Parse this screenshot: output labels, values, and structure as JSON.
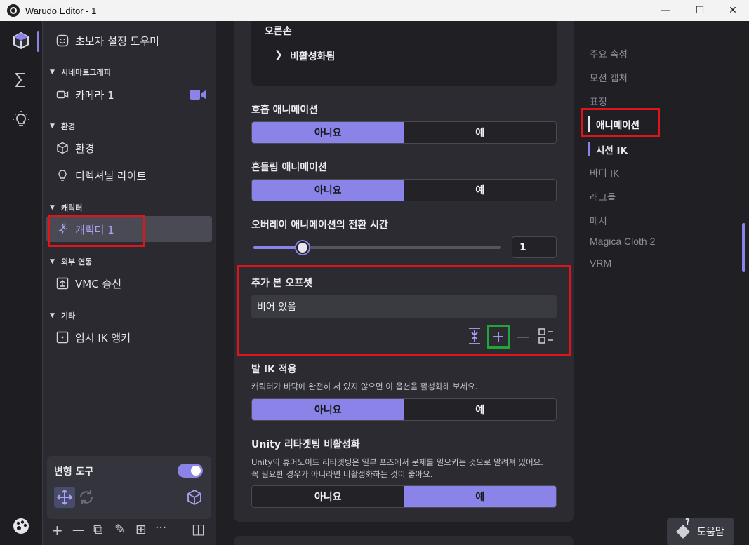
{
  "window": {
    "title": "Warudo Editor - 1",
    "controls": {
      "minimize": "—",
      "maximize": "☐",
      "close": "✕"
    }
  },
  "activity_bar": {
    "items": [
      {
        "name": "scene-cube",
        "glyph": "cube"
      },
      {
        "name": "sigma",
        "glyph": "Σ"
      },
      {
        "name": "lightbulb",
        "glyph": "bulb"
      }
    ]
  },
  "sidebar": {
    "beginner_wizard": "초보자 설정 도우미",
    "sections": {
      "cinematography": "시네마토그래피",
      "environment": "환경",
      "character": "캐릭터",
      "external": "외부 연동",
      "other": "기타"
    },
    "items": {
      "camera": "카메라 1",
      "environment": "환경",
      "directional_light": "디렉셔널 라이트",
      "character": "캐릭터 1",
      "vmc": "VMC 송신",
      "ik_anchor": "임시 IK 앵커"
    },
    "transform_tool": {
      "label": "변형 도구",
      "enabled": true
    },
    "bottom_toolbar": [
      "+",
      "—",
      "⧉",
      "✎",
      "⊞",
      "···",
      "◫"
    ]
  },
  "main": {
    "right_hand": {
      "label": "오른손",
      "status": "비활성화됨"
    },
    "breathing": {
      "label": "호흡 애니메이션",
      "no": "아니요",
      "yes": "예",
      "selected": "no"
    },
    "swaying": {
      "label": "흔들림 애니메이션",
      "no": "아니요",
      "yes": "예",
      "selected": "no"
    },
    "overlay_transition": {
      "label": "오버레이 애니메이션의 전환 시간",
      "value": "1",
      "slider_fraction": 0.2
    },
    "bone_offset": {
      "label": "추가 본 오프셋",
      "empty_text": "비어 있음",
      "tools": [
        "collapse",
        "add",
        "remove",
        "grid"
      ]
    },
    "foot_ik": {
      "label": "발 IK 적용",
      "desc": "캐릭터가 바닥에 완전히 서 있지 않으면 이 옵션을 활성화해 보세요.",
      "no": "아니요",
      "yes": "예",
      "selected": "no"
    },
    "unity_retarget": {
      "label": "Unity 리타겟팅 비활성화",
      "desc_line1": "Unity의 휴머노이드 리타겟팅은 일부 포즈에서 문제를 일으키는 것으로 알려져 있어요.",
      "desc_line2": "꼭 필요한 경우가 아니라면 비활성화하는 것이 좋아요.",
      "no": "아니요",
      "yes": "예",
      "selected": "yes"
    }
  },
  "right_nav": {
    "items": [
      "주요 속성",
      "모션 캡처",
      "표정",
      "애니메이션",
      "시선 IK",
      "바디 IK",
      "래그돌",
      "메시",
      "Magica Cloth 2",
      "VRM"
    ],
    "active": "애니메이션"
  },
  "help": {
    "label": "도움말",
    "badge": "?"
  },
  "colors": {
    "accent": "#8b84e8",
    "highlight_red": "#e0141b",
    "highlight_green": "#1fa53a"
  }
}
